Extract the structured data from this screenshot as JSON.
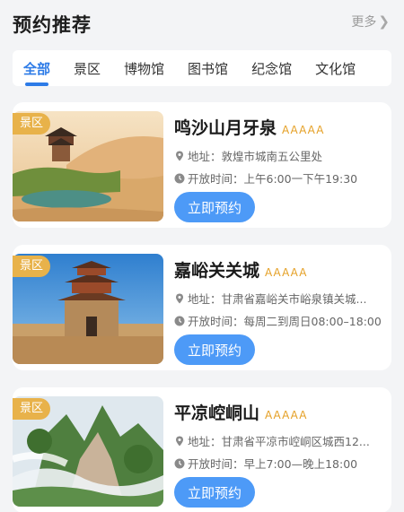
{
  "header": {
    "title": "预约推荐",
    "more_label": "更多"
  },
  "tabs": [
    {
      "label": "全部",
      "active": true
    },
    {
      "label": "景区",
      "active": false
    },
    {
      "label": "博物馆",
      "active": false
    },
    {
      "label": "图书馆",
      "active": false
    },
    {
      "label": "纪念馆",
      "active": false
    },
    {
      "label": "文化馆",
      "active": false
    }
  ],
  "cards": [
    {
      "tag": "景区",
      "name": "鸣沙山月牙泉",
      "grade": "AAAAA",
      "address_label": "地址：",
      "address": "敦煌市城南五公里处",
      "hours_label": "开放时间：",
      "hours": "上午6:00一下午19:30",
      "button": "立即预约"
    },
    {
      "tag": "景区",
      "name": "嘉峪关关城",
      "grade": "AAAAA",
      "address_label": "地址：",
      "address": "甘肃省嘉峪关市峪泉镇关城...",
      "hours_label": "开放时间：",
      "hours": "每周二到周日08:00–18:00",
      "button": "立即预约"
    },
    {
      "tag": "景区",
      "name": "平凉崆峒山",
      "grade": "AAAAA",
      "address_label": "地址：",
      "address": "甘肃省平凉市崆峒区城西12...",
      "hours_label": "开放时间：",
      "hours": "早上7:00—晚上18:00",
      "button": "立即预约"
    }
  ],
  "colors": {
    "accent": "#2d7be7",
    "button": "#4d9af7",
    "tag": "#e8b24a",
    "grade": "#e5a026"
  },
  "icons": {
    "more": "chevron-right-icon",
    "address": "location-pin-icon",
    "hours": "clock-icon"
  }
}
